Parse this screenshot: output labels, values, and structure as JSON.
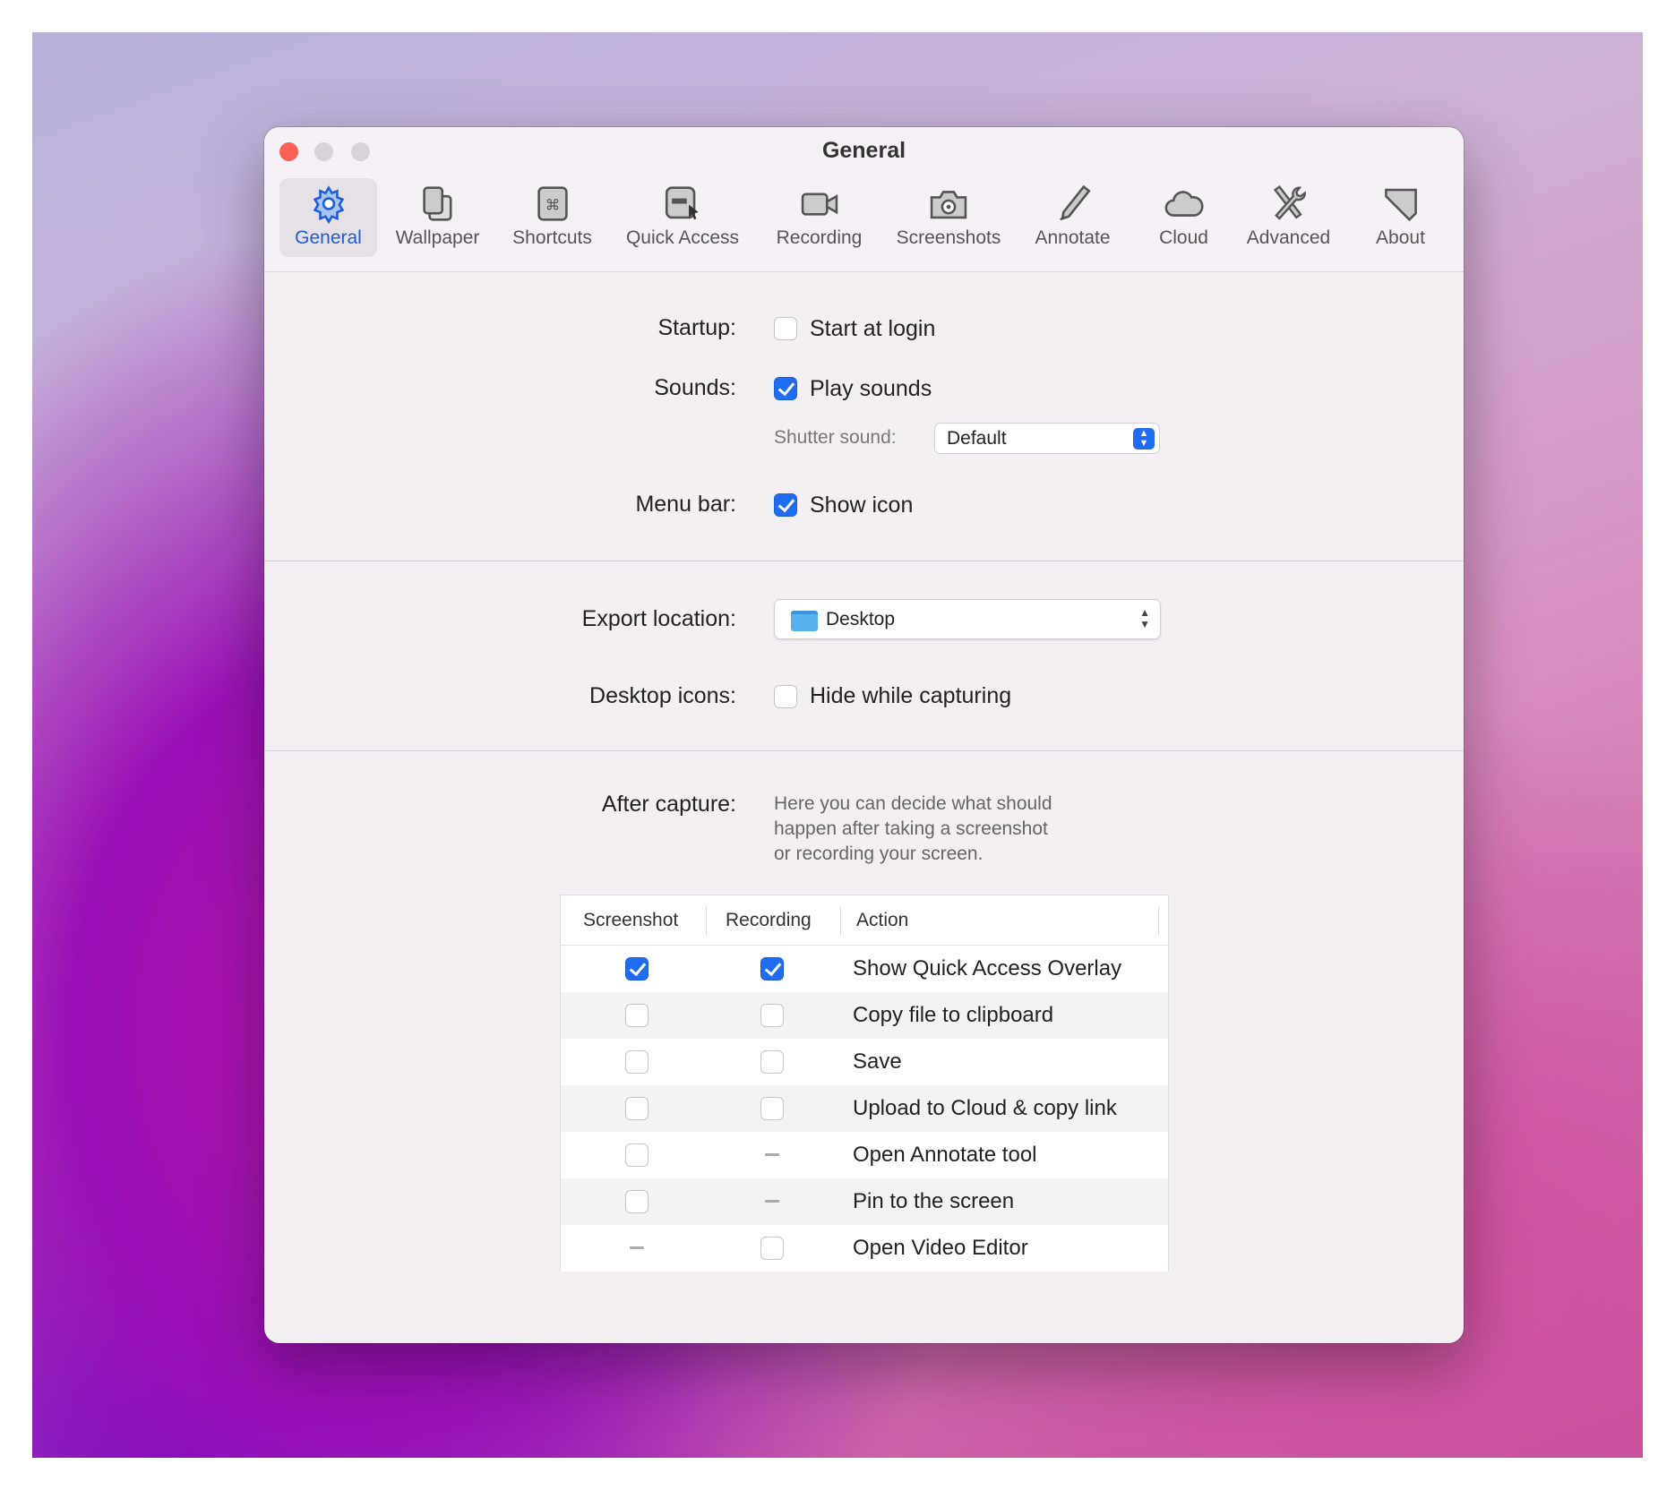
{
  "window": {
    "title": "General",
    "traffic_lights": {
      "close": "#fe5f57",
      "minimize": "#d8d3d8",
      "zoom": "#d8d3d8"
    }
  },
  "toolbar": {
    "items": [
      {
        "label": "General",
        "icon": "gear-icon",
        "selected": true
      },
      {
        "label": "Wallpaper",
        "icon": "wallpaper-icon"
      },
      {
        "label": "Shortcuts",
        "icon": "command-key-icon"
      },
      {
        "label": "Quick Access",
        "icon": "quick-access-icon"
      },
      {
        "label": "Recording",
        "icon": "video-camera-icon"
      },
      {
        "label": "Screenshots",
        "icon": "camera-icon"
      },
      {
        "label": "Annotate",
        "icon": "pencil-icon"
      },
      {
        "label": "Cloud",
        "icon": "cloud-icon"
      },
      {
        "label": "Advanced",
        "icon": "tools-icon"
      },
      {
        "label": "About",
        "icon": "about-icon"
      }
    ]
  },
  "accent": "#1f6cf0",
  "settings": {
    "startup": {
      "label": "Startup:",
      "option": "Start at login",
      "checked": false
    },
    "sounds": {
      "label": "Sounds:",
      "option": "Play sounds",
      "checked": true,
      "shutter_label": "Shutter sound:",
      "shutter_value": "Default"
    },
    "menubar": {
      "label": "Menu bar:",
      "option": "Show icon",
      "checked": true
    },
    "export": {
      "label": "Export location:",
      "value": "Desktop"
    },
    "desktop_icons": {
      "label": "Desktop icons:",
      "option": "Hide while capturing",
      "checked": false
    },
    "after_capture": {
      "label": "After capture:",
      "description": [
        "Here you can decide what should",
        "happen after taking a screenshot",
        "or recording your screen."
      ]
    }
  },
  "table": {
    "headers": [
      "Screenshot",
      "Recording",
      "Action"
    ],
    "rows": [
      {
        "screenshot": true,
        "recording": true,
        "action": "Show Quick Access Overlay"
      },
      {
        "screenshot": false,
        "recording": false,
        "action": "Copy file to clipboard"
      },
      {
        "screenshot": false,
        "recording": false,
        "action": "Save"
      },
      {
        "screenshot": false,
        "recording": false,
        "action": "Upload to Cloud & copy link"
      },
      {
        "screenshot": false,
        "recording": null,
        "action": "Open Annotate tool"
      },
      {
        "screenshot": false,
        "recording": null,
        "action": "Pin to the screen"
      },
      {
        "screenshot": null,
        "recording": false,
        "action": "Open Video Editor"
      }
    ]
  }
}
